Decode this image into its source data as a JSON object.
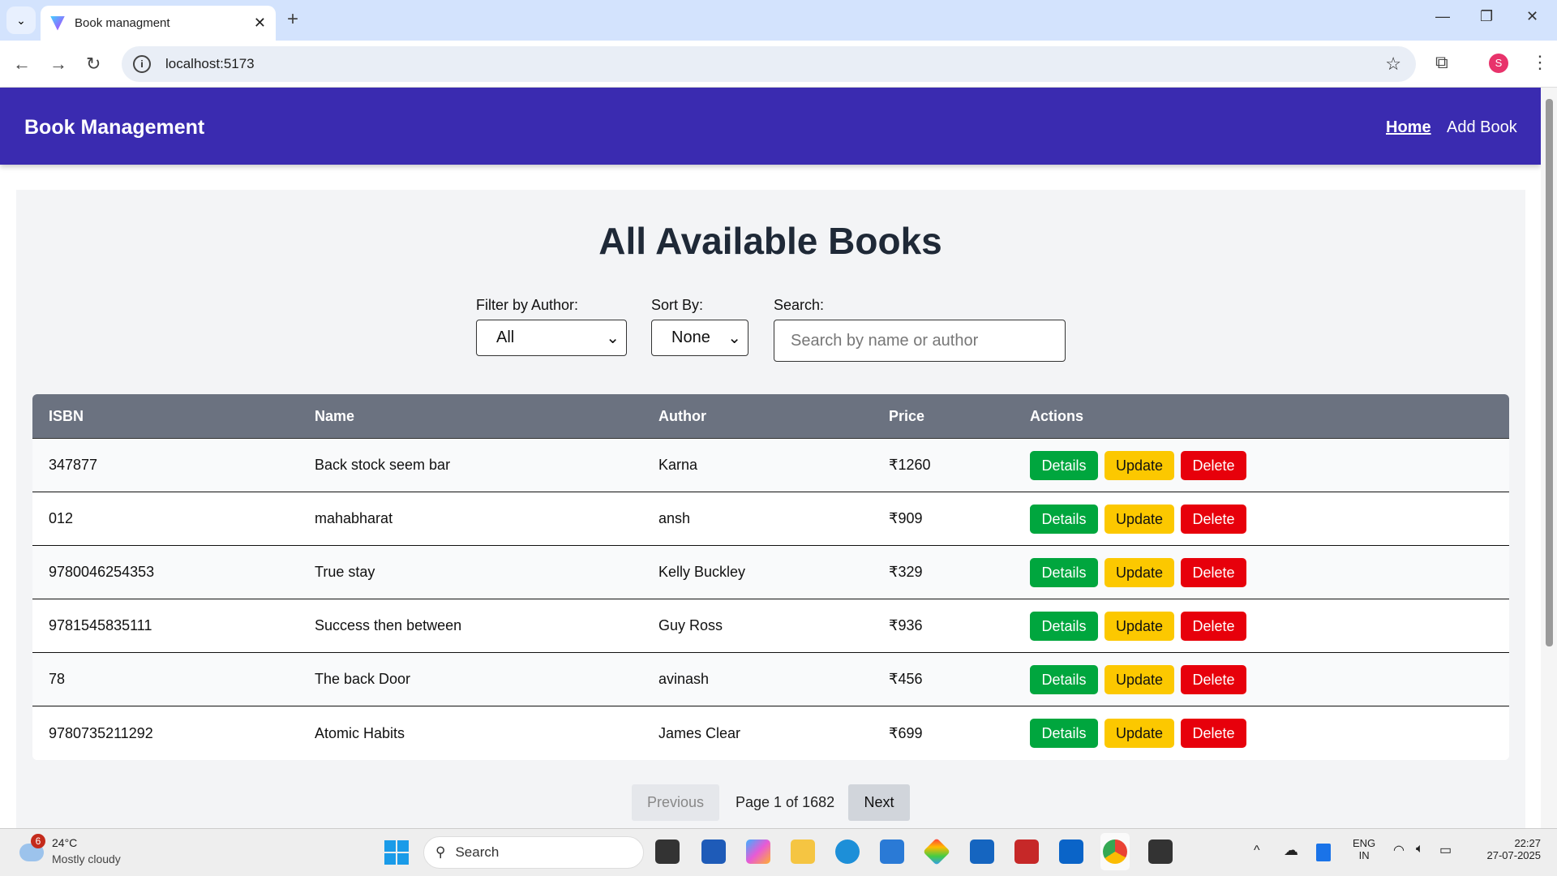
{
  "browser": {
    "tab_title": "Book managment",
    "url": "localhost:5173",
    "profile_initial": "S"
  },
  "navbar": {
    "brand": "Book Management",
    "links": [
      "Home",
      "Add Book"
    ]
  },
  "page": {
    "title": "All Available Books",
    "filters": {
      "author_label": "Filter by Author:",
      "author_value": "All",
      "sort_label": "Sort By:",
      "sort_value": "None",
      "search_label": "Search:",
      "search_placeholder": "Search by name or author"
    },
    "table": {
      "headers": [
        "ISBN",
        "Name",
        "Author",
        "Price",
        "Actions"
      ],
      "rows": [
        {
          "isbn": "347877",
          "name": "Back stock seem bar",
          "author": "Karna",
          "price": "₹1260"
        },
        {
          "isbn": "012",
          "name": "mahabharat",
          "author": "ansh",
          "price": "₹909"
        },
        {
          "isbn": "9780046254353",
          "name": "True stay",
          "author": "Kelly Buckley",
          "price": "₹329"
        },
        {
          "isbn": "9781545835111",
          "name": "Success then between",
          "author": "Guy Ross",
          "price": "₹936"
        },
        {
          "isbn": "78",
          "name": "The back Door",
          "author": "avinash",
          "price": "₹456"
        },
        {
          "isbn": "9780735211292",
          "name": "Atomic Habits",
          "author": "James Clear",
          "price": "₹699"
        }
      ],
      "actions": {
        "details": "Details",
        "update": "Update",
        "delete": "Delete"
      }
    },
    "pagination": {
      "previous": "Previous",
      "info": "Page 1 of 1682",
      "next": "Next"
    }
  },
  "taskbar": {
    "weather_temp": "24°C",
    "weather_desc": "Mostly cloudy",
    "weather_badge": "6",
    "search": "Search",
    "lang1": "ENG",
    "lang2": "IN",
    "time": "22:27",
    "date": "27-07-2025"
  }
}
